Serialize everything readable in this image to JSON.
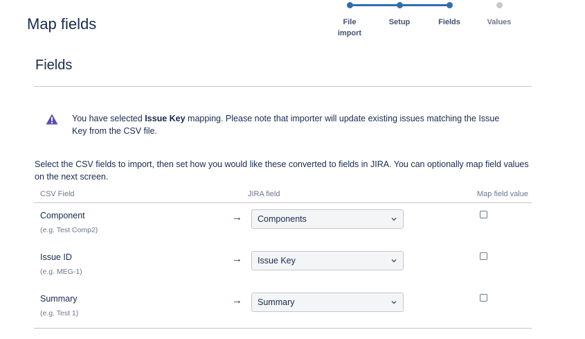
{
  "page": {
    "title": "Map fields"
  },
  "tracker": {
    "steps": [
      {
        "label": "File import",
        "state": "complete"
      },
      {
        "label": "Setup",
        "state": "complete"
      },
      {
        "label": "Fields",
        "state": "current"
      },
      {
        "label": "Values",
        "state": "pending"
      }
    ]
  },
  "section": {
    "title": "Fields"
  },
  "warning": {
    "icon": "warning-triangle-icon",
    "prefix": "You have selected ",
    "bold": "Issue Key",
    "suffix": " mapping. Please note that importer will update existing issues matching the Issue Key from the CSV file."
  },
  "intro": "Select the CSV fields to import, then set how you would like these converted to fields in JIRA. You can optionally map field values on the next screen.",
  "table": {
    "headers": {
      "csv": "CSV Field",
      "jira": "JIRA field",
      "map": "Map field value"
    },
    "rows": [
      {
        "field": "Component",
        "example": "(e.g. Test Comp2)",
        "arrow": "→",
        "jira": "Components",
        "map_checked": false
      },
      {
        "field": "Issue ID",
        "example": "(e.g. MEG-1)",
        "arrow": "→",
        "jira": "Issue Key",
        "map_checked": false
      },
      {
        "field": "Summary",
        "example": "(e.g. Test 1)",
        "arrow": "→",
        "jira": "Summary",
        "map_checked": false
      }
    ]
  },
  "colors": {
    "accent": "#2d6fb1",
    "warning": "#5e4db2",
    "text": "#172b4d",
    "muted": "#6b778c"
  }
}
